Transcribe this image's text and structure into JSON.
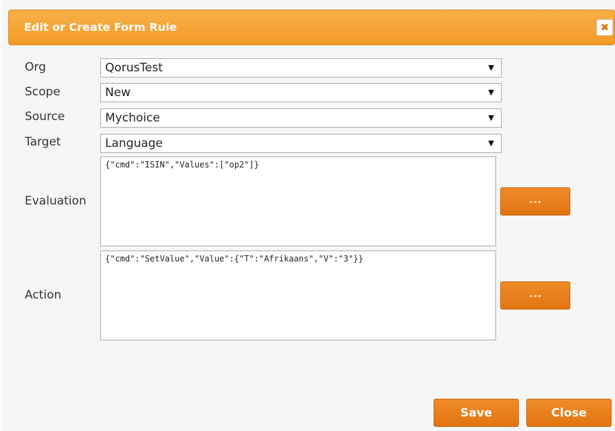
{
  "dialog": {
    "title": "Edit or Create Form Rule",
    "close_glyph": "✖",
    "accent_color": "#f29a25"
  },
  "form": {
    "org": {
      "label": "Org",
      "value": "QorusTest"
    },
    "scope": {
      "label": "Scope",
      "value": "New"
    },
    "source": {
      "label": "Source",
      "value": "Mychoice"
    },
    "target": {
      "label": "Target",
      "value": "Language"
    },
    "evaluation": {
      "label": "Evaluation",
      "value": "{\"cmd\":\"ISIN\",\"Values\":[\"op2\"]}",
      "button_label": "..."
    },
    "action": {
      "label": "Action",
      "value": "{\"cmd\":\"SetValue\",\"Value\":{\"T\":\"Afrikaans\",\"V\":\"3\"}}",
      "button_label": "..."
    },
    "dropdown_arrow": "▼"
  },
  "footer": {
    "save_label": "Save",
    "close_label": "Close"
  }
}
